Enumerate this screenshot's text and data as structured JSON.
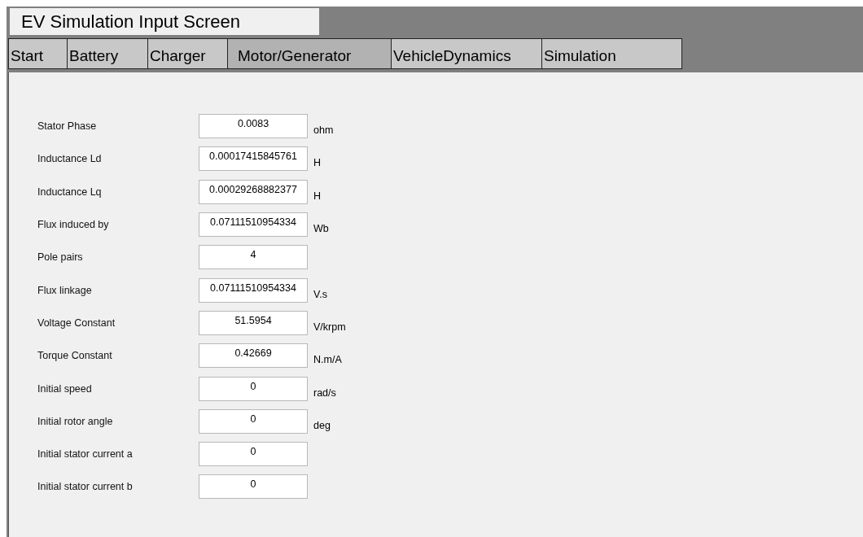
{
  "title": "EV Simulation Input Screen",
  "tabs": [
    {
      "label": "Start",
      "selected": false
    },
    {
      "label": "Battery",
      "selected": false
    },
    {
      "label": "Charger",
      "selected": false
    },
    {
      "label": "Motor/Generator",
      "selected": true
    },
    {
      "label": "VehicleDynamics",
      "selected": false
    },
    {
      "label": "Simulation",
      "selected": false
    }
  ],
  "fields": [
    {
      "label": "Stator Phase",
      "value": "0.0083",
      "unit": "ohm"
    },
    {
      "label": "Inductance Ld",
      "value": "0.00017415845761",
      "unit": "H"
    },
    {
      "label": "Inductance Lq",
      "value": "0.00029268882377",
      "unit": "H"
    },
    {
      "label": "Flux induced by",
      "value": "0.07111510954334",
      "unit": "Wb"
    },
    {
      "label": "Pole pairs",
      "value": "4"
    },
    {
      "label": "Flux linkage",
      "value": "0.07111510954334",
      "unit": "V.s"
    },
    {
      "label": "Voltage Constant",
      "value": "51.5954",
      "unit": "V/krpm"
    },
    {
      "label": "Torque Constant",
      "value": "0.42669",
      "unit": "N.m/A"
    },
    {
      "label": "Initial speed",
      "value": "0",
      "unit": "rad/s"
    },
    {
      "label": "Initial rotor angle",
      "value": "0",
      "unit": "deg"
    },
    {
      "label": "Initial stator current a",
      "value": "0"
    },
    {
      "label": "Initial stator current b",
      "value": "0"
    }
  ]
}
